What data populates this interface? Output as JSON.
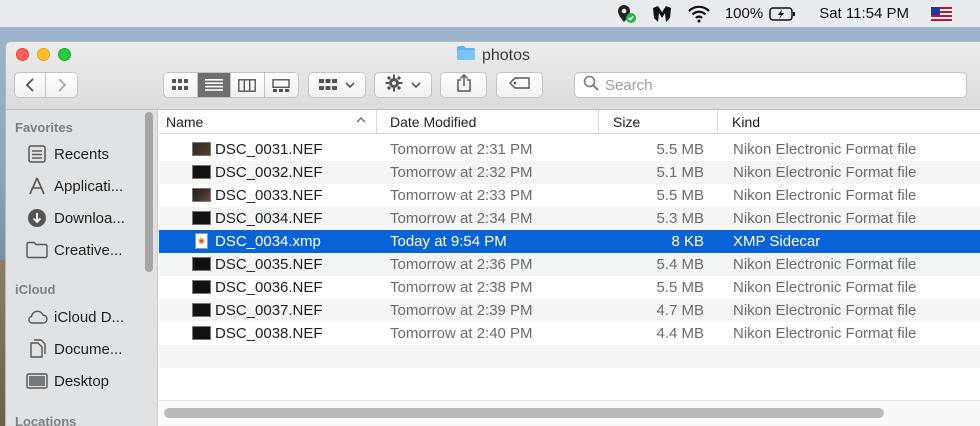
{
  "menubar": {
    "battery": "100%",
    "clock": "Sat 11:54 PM"
  },
  "window": {
    "title": "photos"
  },
  "search": {
    "placeholder": "Search"
  },
  "sidebar": {
    "favorites_header": "Favorites",
    "favorites": [
      {
        "label": "Recents",
        "icon": "recents-icon"
      },
      {
        "label": "Applicati...",
        "icon": "applications-icon"
      },
      {
        "label": "Downloa...",
        "icon": "downloads-icon"
      },
      {
        "label": "Creative...",
        "icon": "folder-icon"
      }
    ],
    "icloud_header": "iCloud",
    "icloud": [
      {
        "label": "iCloud D...",
        "icon": "cloud-icon"
      },
      {
        "label": "Docume...",
        "icon": "documents-icon"
      },
      {
        "label": "Desktop",
        "icon": "desktop-icon"
      }
    ],
    "locations_header": "Locations"
  },
  "columns": {
    "name": "Name",
    "date": "Date Modified",
    "size": "Size",
    "kind": "Kind"
  },
  "files": [
    {
      "name": "DSC_0031.NEF",
      "date": "Tomorrow at 2:31 PM",
      "size": "5.5 MB",
      "kind": "Nikon Electronic Format file"
    },
    {
      "name": "DSC_0032.NEF",
      "date": "Tomorrow at 2:32 PM",
      "size": "5.1 MB",
      "kind": "Nikon Electronic Format file"
    },
    {
      "name": "DSC_0033.NEF",
      "date": "Tomorrow at 2:33 PM",
      "size": "5.5 MB",
      "kind": "Nikon Electronic Format file"
    },
    {
      "name": "DSC_0034.NEF",
      "date": "Tomorrow at 2:34 PM",
      "size": "5.3 MB",
      "kind": "Nikon Electronic Format file"
    },
    {
      "name": "DSC_0034.xmp",
      "date": "Today at 9:54 PM",
      "size": "8 KB",
      "kind": "XMP Sidecar",
      "selected": true
    },
    {
      "name": "DSC_0035.NEF",
      "date": "Tomorrow at 2:36 PM",
      "size": "5.4 MB",
      "kind": "Nikon Electronic Format file"
    },
    {
      "name": "DSC_0036.NEF",
      "date": "Tomorrow at 2:38 PM",
      "size": "5.5 MB",
      "kind": "Nikon Electronic Format file"
    },
    {
      "name": "DSC_0037.NEF",
      "date": "Tomorrow at 2:39 PM",
      "size": "4.7 MB",
      "kind": "Nikon Electronic Format file"
    },
    {
      "name": "DSC_0038.NEF",
      "date": "Tomorrow at 2:40 PM",
      "size": "4.4 MB",
      "kind": "Nikon Electronic Format file"
    }
  ],
  "colors": {
    "selection": "#0a63d6",
    "sidebar_bg": "#dfe3e6"
  }
}
